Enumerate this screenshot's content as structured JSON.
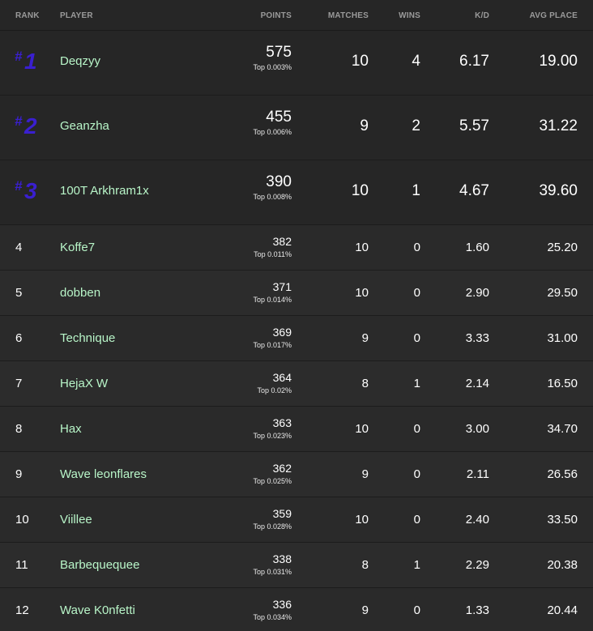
{
  "header": {
    "rank": "RANK",
    "player": "PLAYER",
    "points": "POINTS",
    "matches": "MATCHES",
    "wins": "WINS",
    "kd": "K/D",
    "avg_place": "AVG PLACE"
  },
  "top_rank_symbol": "#",
  "rows": [
    {
      "rank": "1",
      "player": "Deqzyy",
      "points": "575",
      "pct": "Top 0.003%",
      "matches": "10",
      "wins": "4",
      "kd": "6.17",
      "avg": "19.00"
    },
    {
      "rank": "2",
      "player": "Geanzha",
      "points": "455",
      "pct": "Top 0.006%",
      "matches": "9",
      "wins": "2",
      "kd": "5.57",
      "avg": "31.22"
    },
    {
      "rank": "3",
      "player": "100T Arkhram1x",
      "points": "390",
      "pct": "Top 0.008%",
      "matches": "10",
      "wins": "1",
      "kd": "4.67",
      "avg": "39.60"
    },
    {
      "rank": "4",
      "player": "Koffe7",
      "points": "382",
      "pct": "Top 0.011%",
      "matches": "10",
      "wins": "0",
      "kd": "1.60",
      "avg": "25.20"
    },
    {
      "rank": "5",
      "player": "dobben",
      "points": "371",
      "pct": "Top 0.014%",
      "matches": "10",
      "wins": "0",
      "kd": "2.90",
      "avg": "29.50"
    },
    {
      "rank": "6",
      "player": "Technique",
      "points": "369",
      "pct": "Top 0.017%",
      "matches": "9",
      "wins": "0",
      "kd": "3.33",
      "avg": "31.00"
    },
    {
      "rank": "7",
      "player": "HejaX W",
      "points": "364",
      "pct": "Top 0.02%",
      "matches": "8",
      "wins": "1",
      "kd": "2.14",
      "avg": "16.50"
    },
    {
      "rank": "8",
      "player": "Hax",
      "points": "363",
      "pct": "Top 0.023%",
      "matches": "10",
      "wins": "0",
      "kd": "3.00",
      "avg": "34.70"
    },
    {
      "rank": "9",
      "player": "Wave leonflares",
      "points": "362",
      "pct": "Top 0.025%",
      "matches": "9",
      "wins": "0",
      "kd": "2.11",
      "avg": "26.56"
    },
    {
      "rank": "10",
      "player": "Viillee",
      "points": "359",
      "pct": "Top 0.028%",
      "matches": "10",
      "wins": "0",
      "kd": "2.40",
      "avg": "33.50"
    },
    {
      "rank": "11",
      "player": "Barbequequee",
      "points": "338",
      "pct": "Top 0.031%",
      "matches": "8",
      "wins": "1",
      "kd": "2.29",
      "avg": "20.38"
    },
    {
      "rank": "12",
      "player": "Wave K0nfetti",
      "points": "336",
      "pct": "Top 0.034%",
      "matches": "9",
      "wins": "0",
      "kd": "1.33",
      "avg": "20.44"
    }
  ],
  "colors": {
    "background": "#262626",
    "player_name": "#b8f5c8",
    "top_rank": "#3a1fd0",
    "header_text": "#9a9a9a"
  }
}
